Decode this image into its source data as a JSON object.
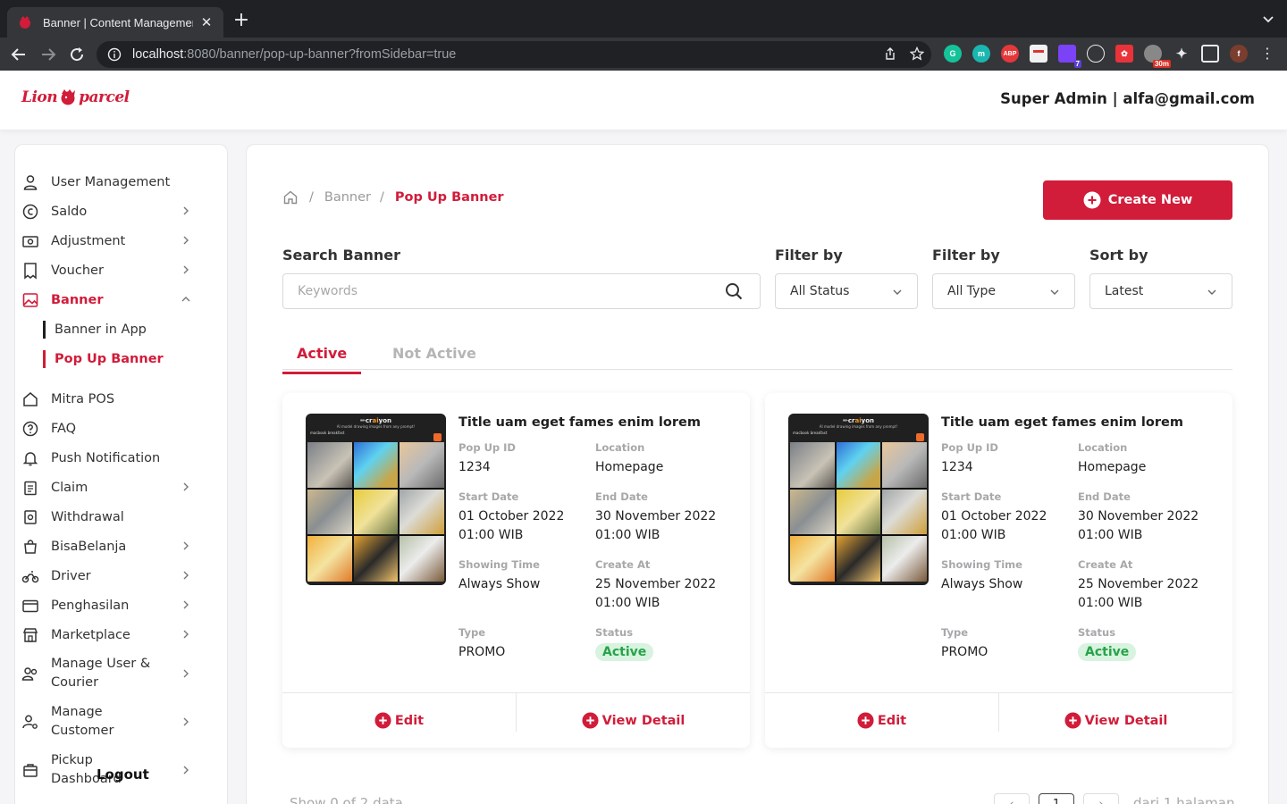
{
  "browser": {
    "tab_title": "Banner | Content Management",
    "url_host": "localhost",
    "url_rest": ":8080/banner/pop-up-banner?fromSidebar=true",
    "extensions": [
      "G",
      "m",
      "ABP",
      "",
      "7",
      "",
      "",
      "30m",
      "",
      "",
      "f"
    ]
  },
  "header": {
    "logo_left": "Lion",
    "logo_right": "parcel",
    "user": "Super Admin | alfa@gmail.com"
  },
  "sidebar": {
    "items": [
      {
        "label": "User Management"
      },
      {
        "label": "Saldo"
      },
      {
        "label": "Adjustment"
      },
      {
        "label": "Voucher"
      },
      {
        "label": "Banner"
      },
      {
        "label": "Mitra POS"
      },
      {
        "label": "FAQ"
      },
      {
        "label": "Push Notification"
      },
      {
        "label": "Claim"
      },
      {
        "label": "Withdrawal"
      },
      {
        "label": "BisaBelanja"
      },
      {
        "label": "Driver"
      },
      {
        "label": "Penghasilan"
      },
      {
        "label": "Marketplace"
      },
      {
        "label": "Manage User & Courier"
      },
      {
        "label": "Manage Customer"
      },
      {
        "label": "Pickup Dashboard"
      }
    ],
    "sub_items": [
      {
        "label": "Banner in App"
      },
      {
        "label": "Pop Up Banner"
      }
    ],
    "logout": "Logout"
  },
  "breadcrumb": {
    "items": [
      "Banner",
      "Pop Up Banner"
    ]
  },
  "create_button": "Create New",
  "filters": {
    "search_label": "Search Banner",
    "search_placeholder": "Keywords",
    "filter1_label": "Filter by",
    "filter1_value": "All Status",
    "filter2_label": "Filter by",
    "filter2_value": "All Type",
    "sort_label": "Sort by",
    "sort_value": "Latest"
  },
  "tabs": [
    "Active",
    "Not Active"
  ],
  "cards": [
    {
      "img_brand": "cr",
      "img_brand_accent": "ai",
      "img_brand_end": "yon",
      "img_caption": "AI model drawing images from any prompt!",
      "img_prompt": "macbook breakfast",
      "title": "Title uam eget fames enim lorem",
      "labels": {
        "id": "Pop Up ID",
        "location": "Location",
        "start": "Start Date",
        "end": "End Date",
        "showing": "Showing Time",
        "created": "Create At",
        "type": "Type",
        "status": "Status"
      },
      "id": "1234",
      "location": "Homepage",
      "start_date": "01 October 2022",
      "start_time": "01:00 WIB",
      "end_date": "30 November 2022",
      "end_time": "01:00 WIB",
      "showing_time": "Always Show",
      "created_date": "25 November 2022",
      "created_time": "01:00 WIB",
      "type": "PROMO",
      "status": "Active",
      "edit": "Edit",
      "view": "View Detail"
    },
    {
      "img_brand": "cr",
      "img_brand_accent": "ai",
      "img_brand_end": "yon",
      "img_caption": "AI model drawing images from any prompt!",
      "img_prompt": "macbook breakfast",
      "title": "Title uam eget fames enim lorem",
      "labels": {
        "id": "Pop Up ID",
        "location": "Location",
        "start": "Start Date",
        "end": "End Date",
        "showing": "Showing Time",
        "created": "Create At",
        "type": "Type",
        "status": "Status"
      },
      "id": "1234",
      "location": "Homepage",
      "start_date": "01 October 2022",
      "start_time": "01:00 WIB",
      "end_date": "30 November 2022",
      "end_time": "01:00 WIB",
      "showing_time": "Always Show",
      "created_date": "25 November 2022",
      "created_time": "01:00 WIB",
      "type": "PROMO",
      "status": "Active",
      "edit": "Edit",
      "view": "View Detail"
    }
  ],
  "pagination": {
    "info": "Show 0 of 2 data",
    "prev": "‹",
    "current": "1",
    "next": "›",
    "total": "dari 1 halaman"
  },
  "colors": {
    "brand": "#d11c3a",
    "status_active_bg": "#d8f3df",
    "status_active_text": "#27a349"
  }
}
